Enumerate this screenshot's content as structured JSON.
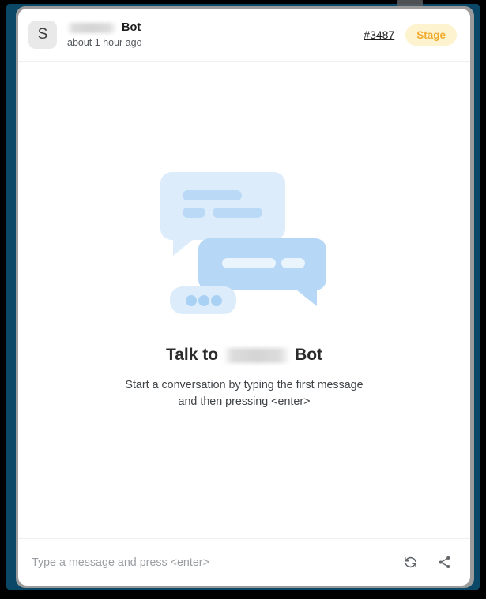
{
  "window": {
    "frame_color": "#0b4868",
    "border_color": "#9b9b9b",
    "background": "#000000"
  },
  "header": {
    "avatar_initial": "S",
    "bot_name_redacted": true,
    "bot_name_suffix": "Bot",
    "timestamp": "about 1 hour ago",
    "ticket_link": "#3487",
    "environment_badge": "Stage",
    "badge_bg": "#fdf3cf",
    "badge_text_color": "#f0ab2d"
  },
  "empty_state": {
    "illustration": {
      "name": "chat-bubbles-illustration",
      "bubble_light": "#ddecfa",
      "bubble_mid": "#b6d7f5",
      "bubble_line_light": "#b9d9f6",
      "bubble_line_white": "#eaf4fd",
      "dot_color": "#a9d1f4"
    },
    "title_prefix": "Talk to",
    "title_redacted": true,
    "title_suffix": "Bot",
    "subtitle_line_1": "Start a conversation by typing the first message",
    "subtitle_line_2": "and then pressing <enter>"
  },
  "composer": {
    "placeholder": "Type a message and press <enter>",
    "value": "",
    "actions": [
      {
        "name": "refresh-icon",
        "label": "Restart conversation"
      },
      {
        "name": "share-icon",
        "label": "Share conversation"
      }
    ]
  }
}
